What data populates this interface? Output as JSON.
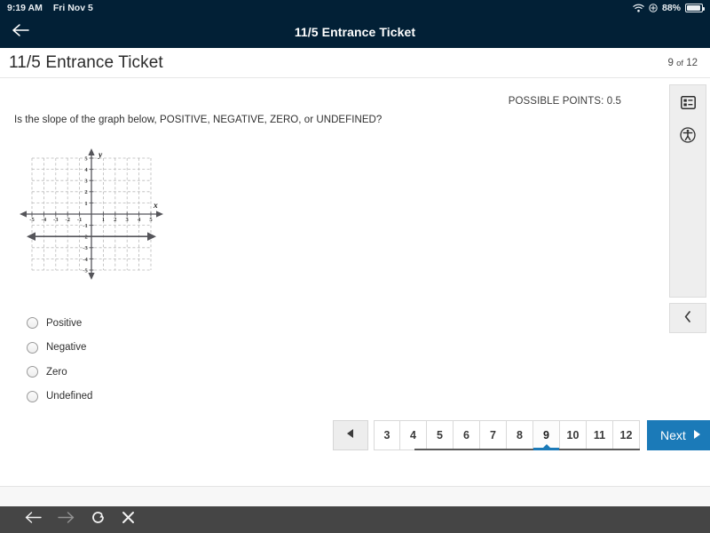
{
  "status_bar": {
    "time": "9:19 AM",
    "date": "Fri Nov 5",
    "battery_percent": "88%",
    "wifi_icon": "wifi-icon",
    "location_icon": "location-services-icon",
    "battery_icon": "battery-icon"
  },
  "app_bar": {
    "back_icon": "back-arrow-icon",
    "title": "11/5 Entrance Ticket",
    "background": "#022036"
  },
  "page_header": {
    "title": "11/5 Entrance Ticket",
    "current_page": "9",
    "of_label": "of",
    "total_pages": "12"
  },
  "assessment": {
    "possible_points_label": "POSSIBLE POINTS: 0.5",
    "question_text": "Is the slope of the graph below, POSITIVE, NEGATIVE, ZERO, or UNDEFINED?"
  },
  "choices": [
    {
      "label": "Positive",
      "selected": false
    },
    {
      "label": "Negative",
      "selected": false
    },
    {
      "label": "Zero",
      "selected": false
    },
    {
      "label": "Undefined",
      "selected": false
    }
  ],
  "tool_rail": {
    "outline_icon": "list-outline-icon",
    "accessibility_icon": "accessibility-icon",
    "collapse_icon": "chevron-left-icon"
  },
  "pagination": {
    "prev_icon": "prev-triangle-icon",
    "pages": [
      "3",
      "4",
      "5",
      "6",
      "7",
      "8",
      "9",
      "10",
      "11",
      "12"
    ],
    "active_page": "9",
    "next_label": "Next",
    "next_icon": "next-triangle-icon",
    "accent_color": "#1b7ab8"
  },
  "bottom_nav": {
    "back_icon": "browser-back-icon",
    "forward_icon": "browser-forward-icon",
    "reload_icon": "browser-reload-icon",
    "close_icon": "browser-close-icon"
  },
  "chart_data": {
    "type": "line",
    "title": "",
    "xlabel": "x",
    "ylabel": "y",
    "xlim": [
      -5,
      5
    ],
    "ylim": [
      -5,
      5
    ],
    "xticks": [
      -5,
      -4,
      -3,
      -2,
      -1,
      1,
      2,
      3,
      4,
      5
    ],
    "yticks": [
      5,
      4,
      3,
      2,
      1,
      -1,
      -2,
      -3,
      -4,
      -5
    ],
    "grid": true,
    "grid_style": "dashed",
    "legend": "none",
    "series": [
      {
        "name": "horizontal line",
        "equation": "y = -2",
        "slope": 0,
        "x": [
          -5,
          5
        ],
        "values": [
          -2,
          -2
        ],
        "arrows": "both"
      }
    ]
  }
}
